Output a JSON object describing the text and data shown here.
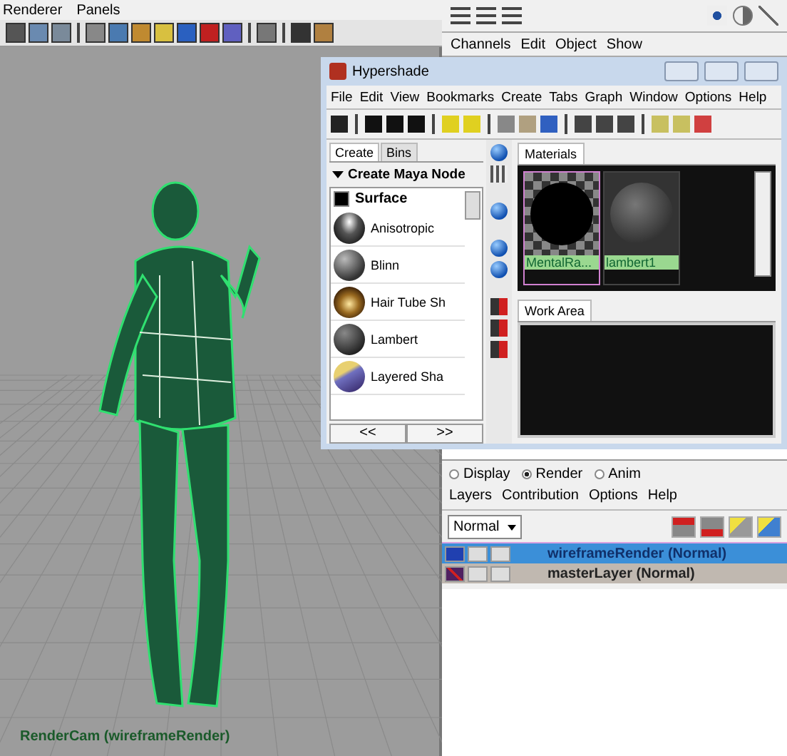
{
  "viewport": {
    "menu": [
      "Renderer",
      "Panels"
    ],
    "camera_label": "RenderCam (wireframeRender)"
  },
  "channel_box": {
    "menu": [
      "Channels",
      "Edit",
      "Object",
      "Show"
    ]
  },
  "hypershade": {
    "title": "Hypershade",
    "menu": [
      "File",
      "Edit",
      "View",
      "Bookmarks",
      "Create",
      "Tabs",
      "Graph",
      "Window",
      "Options",
      "Help"
    ],
    "create_tabs": [
      {
        "label": "Create",
        "selected": true
      },
      {
        "label": "Bins",
        "selected": false
      }
    ],
    "section": "Create Maya Node",
    "category": "Surface",
    "nodes": [
      {
        "label": "Anisotropic",
        "kind": "anisotropic"
      },
      {
        "label": "Blinn",
        "kind": "blinn"
      },
      {
        "label": "Hair Tube Sh",
        "kind": "hair"
      },
      {
        "label": "Lambert",
        "kind": "lambert"
      },
      {
        "label": "Layered Sha",
        "kind": "layered"
      }
    ],
    "nav_buttons": [
      "<<",
      ">>"
    ],
    "materials_tab": "Materials",
    "swatches": [
      {
        "label": "MentalRa...",
        "kind": "checker",
        "selected": true
      },
      {
        "label": "lambert1",
        "kind": "plain",
        "selected": false
      }
    ],
    "work_area_tab": "Work Area"
  },
  "layer_editor": {
    "modes": [
      {
        "label": "Display",
        "selected": false
      },
      {
        "label": "Render",
        "selected": true
      },
      {
        "label": "Anim",
        "selected": false
      }
    ],
    "menu": [
      "Layers",
      "Contribution",
      "Options",
      "Help"
    ],
    "blend_mode": "Normal",
    "layers": [
      {
        "label": "wireframeRender (Normal)",
        "selected": true
      },
      {
        "label": "masterLayer (Normal)",
        "selected": false
      }
    ]
  }
}
